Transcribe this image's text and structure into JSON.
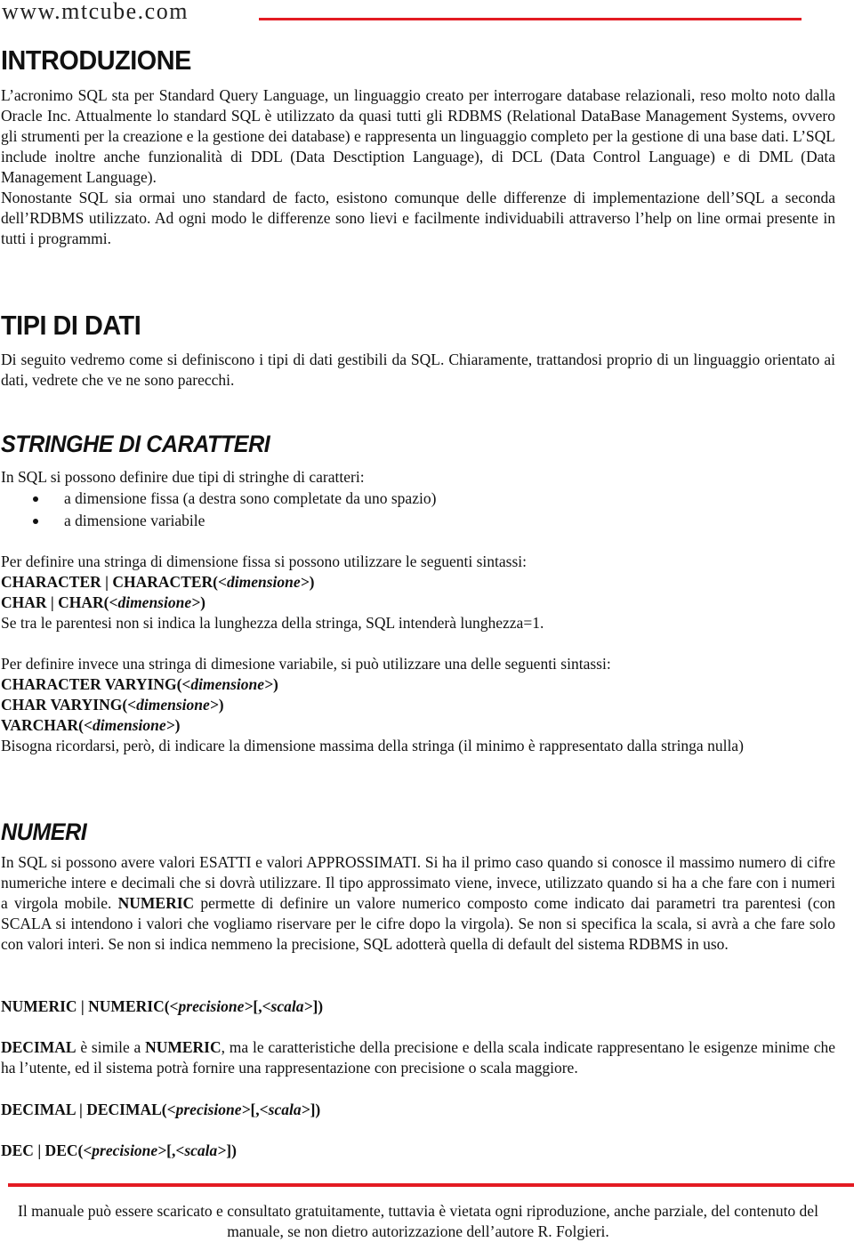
{
  "header": {
    "site": "www.mtcube.com",
    "accent_color": "#e31b23"
  },
  "sections": {
    "introduzione": {
      "title": "INTRODUZIONE",
      "paragraph1": "L’acronimo SQL sta per Standard Query Language, un linguaggio creato per interrogare database relazionali, reso molto noto dalla Oracle Inc. Attualmente lo standard SQL è utilizzato da quasi tutti gli RDBMS (Relational DataBase Management Systems, ovvero gli strumenti per la creazione e la gestione dei database) e rappresenta un linguaggio completo per la gestione di una base dati. L’SQL include inoltre anche funzionalità di DDL (Data Desctiption Language), di DCL (Data Control Language) e di DML (Data Management Language).",
      "paragraph2": "Nonostante SQL sia ormai uno standard de facto, esistono comunque delle differenze di implementazione dell’SQL a seconda dell’RDBMS utilizzato. Ad ogni modo le differenze sono lievi e facilmente individuabili attraverso l’help on line ormai presente in tutti i programmi."
    },
    "tipi_di_dati": {
      "title": "TIPI DI DATI",
      "paragraph": "Di seguito vedremo come si definiscono i tipi di dati gestibili da SQL. Chiaramente, trattandosi proprio di un linguaggio orientato ai dati, vedrete che ve ne sono parecchi."
    },
    "stringhe": {
      "title": "STRINGHE DI CARATTERI",
      "intro": "In SQL si possono definire due tipi di stringhe di caratteri:",
      "bullets": [
        "a dimensione fissa (a destra sono completate da uno spazio)",
        "a dimensione variabile"
      ],
      "fixed_intro": "Per definire una stringa di dimensione fissa si possono utilizzare le seguenti sintassi:",
      "fixed_syntax": [
        {
          "keyword": "CHARACTER | CHARACTER(",
          "param": "<dimensione>",
          "close": ")"
        },
        {
          "keyword": "CHAR | CHAR(",
          "param": "<dimensione>",
          "close": ")"
        }
      ],
      "fixed_note": "Se tra le parentesi non si indica la lunghezza della stringa, SQL intenderà lunghezza=1.",
      "variable_intro": "Per definire invece una stringa di dimesione variabile, si può utilizzare una delle seguenti sintassi:",
      "variable_syntax": [
        {
          "keyword": "CHARACTER VARYING(",
          "param": "<dimensione>",
          "close": ")"
        },
        {
          "keyword": "CHAR VARYING(",
          "param": "<dimensione>",
          "close": ")"
        },
        {
          "keyword": "VARCHAR(",
          "param": "<dimensione>",
          "close": ")"
        }
      ],
      "variable_note": "Bisogna ricordarsi, però, di indicare la dimensione massima della stringa (il minimo è rappresentato dalla stringa nulla)"
    },
    "numeri": {
      "title": "NUMERI",
      "paragraph_a": "In SQL si possono avere valori ESATTI e valori APPROSSIMATI. Si ha il primo caso quando si conosce il massimo numero di cifre numeriche intere e decimali che si dovrà utilizzare. Il tipo approssimato viene, invece, utilizzato quando si ha a che fare con i numeri a virgola mobile. ",
      "paragraph_bold": "NUMERIC",
      "paragraph_b": " permette di definire un valore numerico composto come indicato dai parametri tra parentesi (con SCALA si intendono i valori che vogliamo riservare per le cifre dopo la virgola). Se non si specifica la scala, si avrà a che fare solo con valori interi. Se non si indica nemmeno la precisione, SQL adotterà quella di default del sistema RDBMS in uso.",
      "numeric_syntax": {
        "keyword": "NUMERIC | NUMERIC(",
        "p1": "<precisione>",
        "mid": "[,",
        "p2": "<scala>",
        "close": "])"
      },
      "decimal_bold1": "DECIMAL",
      "decimal_text1": " è simile a ",
      "decimal_bold2": "NUMERIC",
      "decimal_text2": ", ma le caratteristiche della precisione e della scala indicate rappresentano le esigenze minime che ha l’utente, ed il sistema potrà fornire una rappresentazione con precisione o scala maggiore.",
      "decimal_syntax": {
        "keyword": "DECIMAL | DECIMAL(",
        "p1": "<precisione>",
        "mid": "[,",
        "p2": "<scala>",
        "close": "])"
      },
      "dec_syntax": {
        "keyword": "DEC | DEC(",
        "p1": "<precisione>",
        "mid": "[,",
        "p2": "<scala>",
        "close": "])"
      }
    }
  },
  "footer": {
    "text": "Il manuale può essere scaricato e consultato gratuitamente, tuttavia è vietata ogni riproduzione, anche parziale, del contenuto del manuale, se non dietro autorizzazione dell’autore R. Folgieri."
  }
}
